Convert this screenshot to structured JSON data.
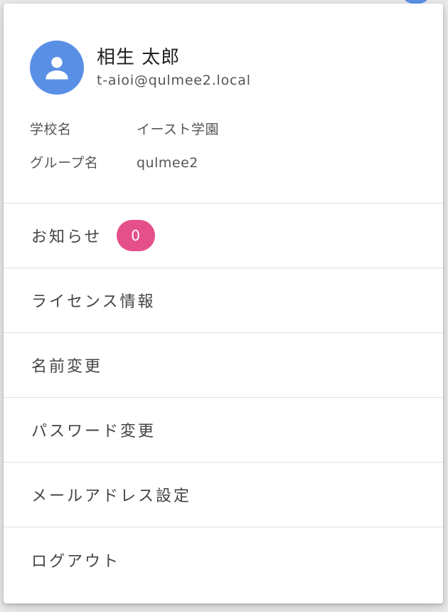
{
  "colors": {
    "avatar_bg": "#5a8fe6",
    "badge_bg": "#e5508b",
    "divider": "#e0e0e0"
  },
  "profile": {
    "avatar_icon": "person-icon",
    "name": "相生 太郎",
    "email": "t-aioi@qulmee2.local",
    "school_label": "学校名",
    "school_value": "イースト学園",
    "group_label": "グループ名",
    "group_value": "qulmee2"
  },
  "menu": {
    "notifications_label": "お知らせ",
    "notifications_count": "0",
    "license_label": "ライセンス情報",
    "change_name_label": "名前変更",
    "change_password_label": "パスワード変更",
    "email_settings_label": "メールアドレス設定",
    "logout_label": "ログアウト"
  }
}
